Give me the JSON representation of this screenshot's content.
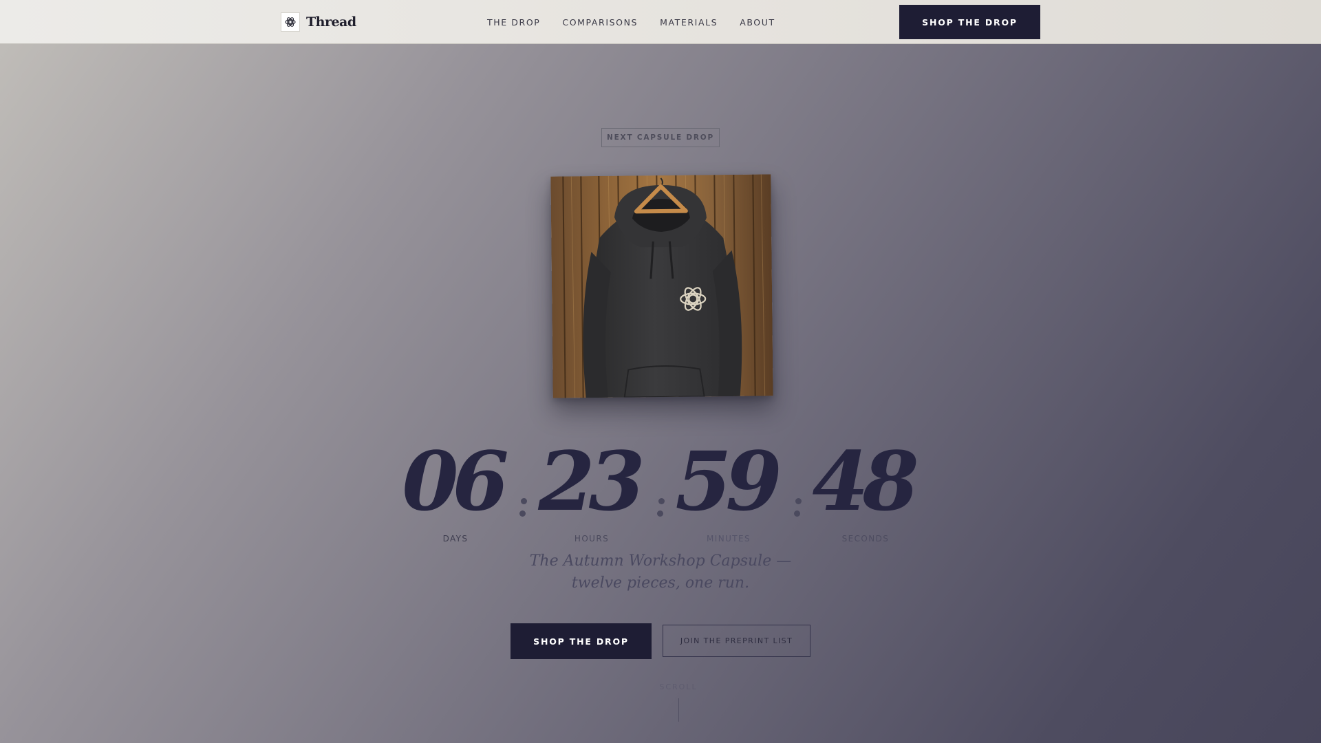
{
  "brand": {
    "name": "Thread",
    "logo_icon": "knot-logo-icon"
  },
  "nav": {
    "items": [
      {
        "label": "THE DROP"
      },
      {
        "label": "COMPARISONS"
      },
      {
        "label": "MATERIALS"
      },
      {
        "label": "ABOUT"
      }
    ],
    "cta_label": "SHOP THE DROP"
  },
  "hero": {
    "eyebrow": "NEXT CAPSULE DROP",
    "product_image": "charcoal hoodie with embroidered knot emblem hanging on a wooden hanger against a wooden plank wall",
    "countdown": [
      {
        "value": "06",
        "label": "DAYS"
      },
      {
        "value": "23",
        "label": "HOURS"
      },
      {
        "value": "59",
        "label": "MINUTES"
      },
      {
        "value": "48",
        "label": "SECONDS"
      }
    ],
    "tagline": "The Autumn Workshop Capsule — twelve pieces, one run.",
    "primary_cta": "SHOP THE DROP",
    "secondary_cta": "JOIN THE PREPRINT LIST",
    "scroll_label": "SCROLL"
  },
  "colors": {
    "accent_navy": "#1e1d34",
    "digit_ink": "#262540",
    "header_bg": "#e8e6e2",
    "button_text": "#ffffff"
  }
}
